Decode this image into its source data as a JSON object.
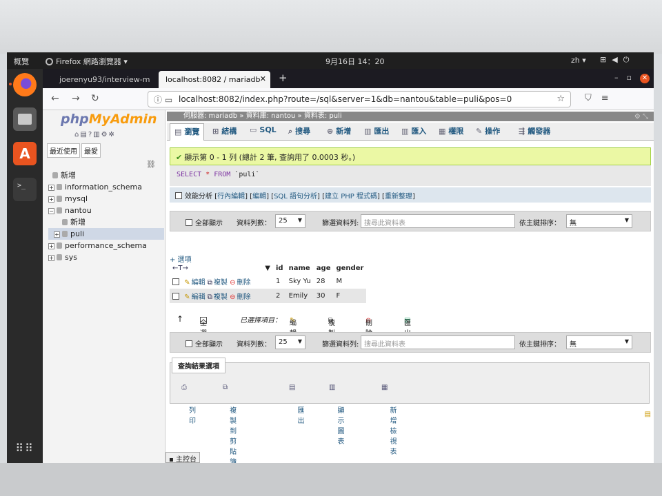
{
  "os": {
    "activities": "概覽",
    "app_menu": "Firefox 網路瀏覽器 ▾",
    "clock": "9月16日  14：20",
    "lang": "zh ▾"
  },
  "browser": {
    "tabs": [
      {
        "label": "joerenyu93/interview-m"
      },
      {
        "label": "localhost:8082 / mariadb"
      }
    ],
    "url": "localhost:8082/index.php?route=/sql&server=1&db=nantou&table=puli&pos=0"
  },
  "pma": {
    "logo_php": "php",
    "logo_my": "MyAdmin",
    "nav_tabs": [
      "最近使用",
      "最愛"
    ],
    "tree": [
      {
        "label": "新增",
        "level": 0
      },
      {
        "label": "information_schema",
        "level": 0
      },
      {
        "label": "mysql",
        "level": 0
      },
      {
        "label": "nantou",
        "level": 0
      },
      {
        "label": "新增",
        "level": 1
      },
      {
        "label": "puli",
        "level": 1
      },
      {
        "label": "performance_schema",
        "level": 0
      },
      {
        "label": "sys",
        "level": 0
      }
    ],
    "breadcrumb": {
      "server": "伺服器: mariadb",
      "database": "資料庫: nantou",
      "table": "資料表: puli"
    },
    "tabs": [
      "瀏覽",
      "結構",
      "SQL",
      "搜尋",
      "新增",
      "匯出",
      "匯入",
      "權限",
      "操作",
      "觸發器"
    ],
    "success_msg": "顯示第 0 - 1 列 (總計 2 筆, 查詢用了 0.0003 秒。)",
    "sql": {
      "select": "SELECT",
      "star": "*",
      "from": "FROM",
      "table": "`puli`"
    },
    "sql_links": {
      "profiling": "效能分析",
      "inline_edit": "行內編輯",
      "edit": "編輯",
      "explain": "SQL 語句分析",
      "php_code": "建立 PHP 程式碼",
      "refresh": "重新整理"
    },
    "nav_bar": {
      "show_all": "全部顯示",
      "rows_label": "資料列數：",
      "rows_value": "25",
      "filter_label": "篩選資料列:",
      "filter_placeholder": "搜尋此資料表",
      "sort_label": "依主鍵排序：",
      "sort_value": "無"
    },
    "options_link": "+ 選項",
    "columns": [
      "id",
      "name",
      "age",
      "gender"
    ],
    "row_actions": {
      "edit": "編輯",
      "copy": "複製",
      "delete": "刪除"
    },
    "rows": [
      {
        "id": "1",
        "name": "Sky Yu",
        "age": "28",
        "gender": "M"
      },
      {
        "id": "2",
        "name": "Emily",
        "age": "30",
        "gender": "F"
      }
    ],
    "bulk": {
      "check_all": "全選",
      "with_selected": "已選擇項目：",
      "edit": "編輯",
      "copy": "複製",
      "delete": "刪除",
      "export": "匯出"
    },
    "query_ops": {
      "legend": "查詢結果選項",
      "print": "列印",
      "copy_clipboard": "複製到剪貼簿",
      "export": "匯出",
      "chart": "顯示圖表",
      "create_view": "新增檢視表"
    },
    "console": "主控台"
  }
}
